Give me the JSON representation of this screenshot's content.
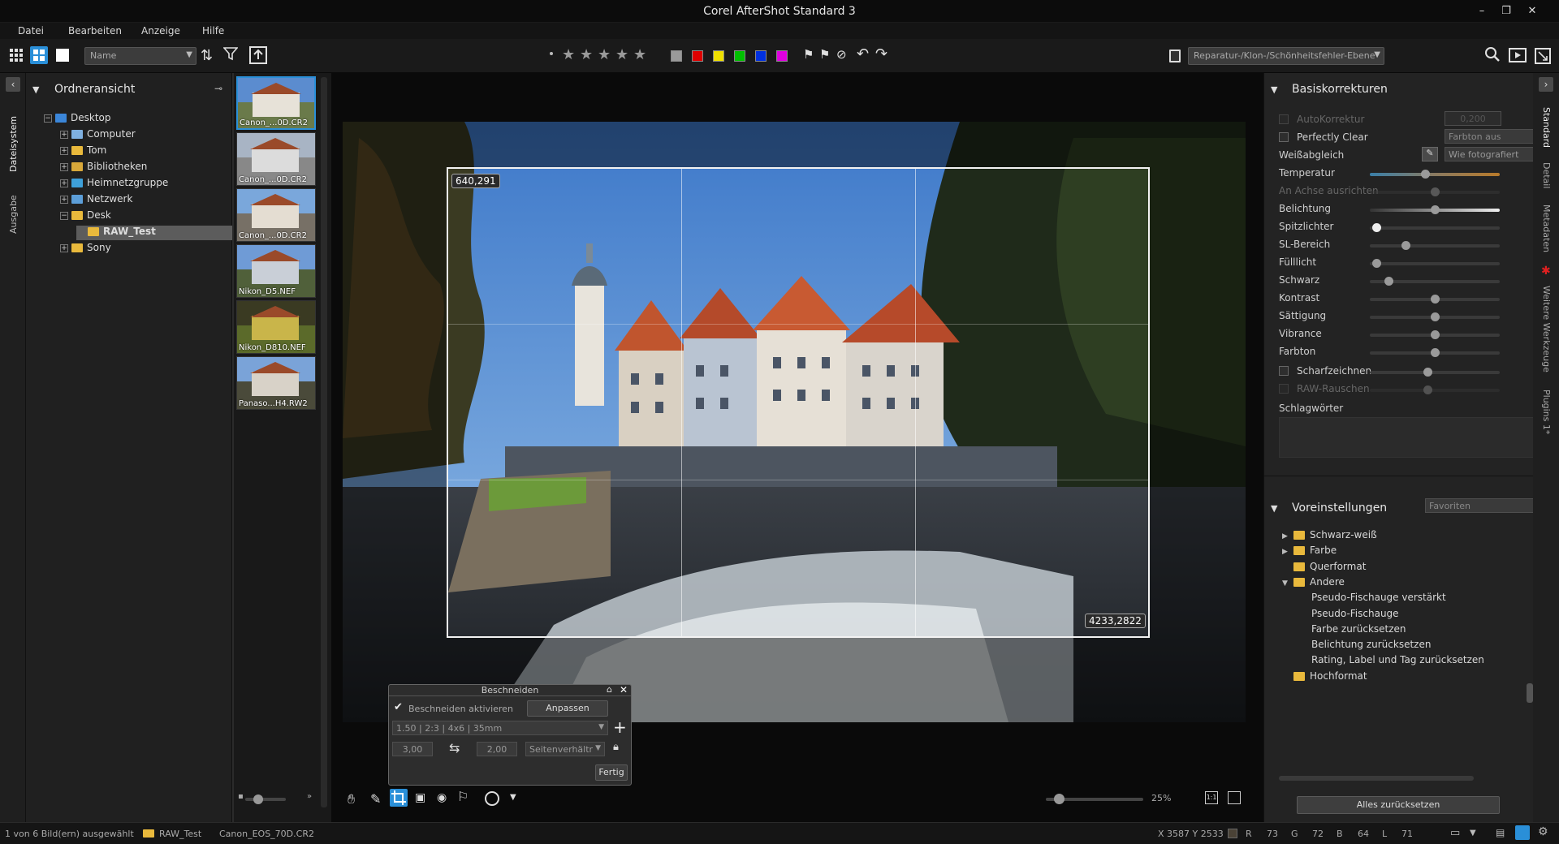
{
  "window": {
    "title": "Corel AfterShot Standard 3"
  },
  "menu": [
    "Datei",
    "Bearbeiten",
    "Anzeige",
    "Hilfe"
  ],
  "toolbar": {
    "sort_combo": "Name",
    "layer_combo": "Reparatur-/Klon-/Schönheitsfehler-Ebene",
    "color_labels": [
      "#9a9a9a",
      "#e00000",
      "#f0e000",
      "#00c000",
      "#0030e0",
      "#e000e0"
    ]
  },
  "left_strip": {
    "tabs": [
      "Dateisystem",
      "Ausgabe"
    ]
  },
  "folder_panel": {
    "title": "Ordneransicht",
    "tree": [
      {
        "label": "Desktop",
        "level": 0,
        "icon": "desktop-icon",
        "expander": "−"
      },
      {
        "label": "Computer",
        "level": 1,
        "icon": "computer-icon",
        "expander": "+"
      },
      {
        "label": "Tom",
        "level": 1,
        "icon": "folder-icon",
        "expander": "+"
      },
      {
        "label": "Bibliotheken",
        "level": 1,
        "icon": "library-icon",
        "expander": "+"
      },
      {
        "label": "Heimnetzgruppe",
        "level": 1,
        "icon": "homegroup-icon",
        "expander": "+"
      },
      {
        "label": "Netzwerk",
        "level": 1,
        "icon": "network-icon",
        "expander": "+"
      },
      {
        "label": "Desk",
        "level": 1,
        "icon": "folder-icon",
        "expander": "−"
      },
      {
        "label": "RAW_Test",
        "level": 2,
        "icon": "folder-icon",
        "expander": "",
        "selected": true
      },
      {
        "label": "Sony",
        "level": 1,
        "icon": "folder-icon",
        "expander": "+"
      }
    ]
  },
  "thumbnails": [
    {
      "label": "Canon_...0D.CR2",
      "selected": true
    },
    {
      "label": "Canon_...0D.CR2"
    },
    {
      "label": "Canon_...0D.CR2"
    },
    {
      "label": "Nikon_D5.NEF"
    },
    {
      "label": "Nikon_D810.NEF"
    },
    {
      "label": "Panaso...H4.RW2"
    }
  ],
  "viewer": {
    "crop_start": "640,291",
    "crop_end": "4233,2822",
    "zoom": "25%"
  },
  "crop_dialog": {
    "title": "Beschneiden",
    "enable_label": "Beschneiden aktivieren",
    "enable_checked": true,
    "adjust_button": "Anpassen",
    "ratio_select": "1.50 | 2:3 | 4x6 | 35mm",
    "width": "3,00",
    "height": "2,00",
    "mode_select": "Seitenverhältr",
    "done_button": "Fertig"
  },
  "basic": {
    "title": "Basiskorrekturen",
    "autokorrektur": "AutoKorrektur",
    "autokorrektur_value": "0,200",
    "perfectly_clear": "Perfectly Clear",
    "farbton_combo": "Farbton aus",
    "weissabgleich": "Weißabgleich",
    "wb_combo": "Wie fotografiert",
    "sliders": [
      {
        "label": "Temperatur",
        "value": 0.42,
        "dim": false,
        "gradient": true
      },
      {
        "label": "An Achse ausrichten",
        "value": 0.5,
        "dim": true
      },
      {
        "label": "Belichtung",
        "value": 0.5,
        "dim": false,
        "bright": true
      },
      {
        "label": "Spitzlichter",
        "value": 0.02,
        "dim": false,
        "highlight": true
      },
      {
        "label": "SL-Bereich",
        "value": 0.26,
        "dim": false
      },
      {
        "label": "Fülllicht",
        "value": 0.02,
        "dim": false
      },
      {
        "label": "Schwarz",
        "value": 0.12,
        "dim": false
      },
      {
        "label": "Kontrast",
        "value": 0.5,
        "dim": false
      },
      {
        "label": "Sättigung",
        "value": 0.5,
        "dim": false
      },
      {
        "label": "Vibrance",
        "value": 0.5,
        "dim": false
      },
      {
        "label": "Farbton",
        "value": 0.5,
        "dim": false
      }
    ],
    "scharfzeichnen": "Scharfzeichnen",
    "raw_rauschen": "RAW-Rauschen",
    "schlagwoerter": "Schlagwörter"
  },
  "presets": {
    "title": "Voreinstellungen",
    "combo": "Favoriten",
    "items": [
      {
        "label": "Schwarz-weiß",
        "type": "folder",
        "arrow": "▶"
      },
      {
        "label": "Farbe",
        "type": "folder",
        "arrow": "▶"
      },
      {
        "label": "Querformat",
        "type": "folder",
        "arrow": ""
      },
      {
        "label": "Andere",
        "type": "folder",
        "arrow": "▼"
      },
      {
        "label": "Pseudo-Fischauge verstärkt",
        "type": "item"
      },
      {
        "label": "Pseudo-Fischauge",
        "type": "item"
      },
      {
        "label": "Farbe zurücksetzen",
        "type": "item"
      },
      {
        "label": "Belichtung zurücksetzen",
        "type": "item"
      },
      {
        "label": "Rating, Label und Tag zurücksetzen",
        "type": "item"
      },
      {
        "label": "Hochformat",
        "type": "folder",
        "arrow": ""
      }
    ],
    "reset_button": "Alles zurücksetzen"
  },
  "right_strip": {
    "tabs": [
      "Standard",
      "Detail",
      "Metadaten",
      "Weitere Werkzeuge",
      "Plugins 1*"
    ]
  },
  "status": {
    "selection": "1 von 6 Bild(ern) ausgewählt",
    "folder": "RAW_Test",
    "file": "Canon_EOS_70D.CR2",
    "coords": "X 3587  Y 2533",
    "r_label": "R",
    "r": "73",
    "g_label": "G",
    "g": "72",
    "b_label": "B",
    "b": "64",
    "l_label": "L",
    "l": "71"
  }
}
